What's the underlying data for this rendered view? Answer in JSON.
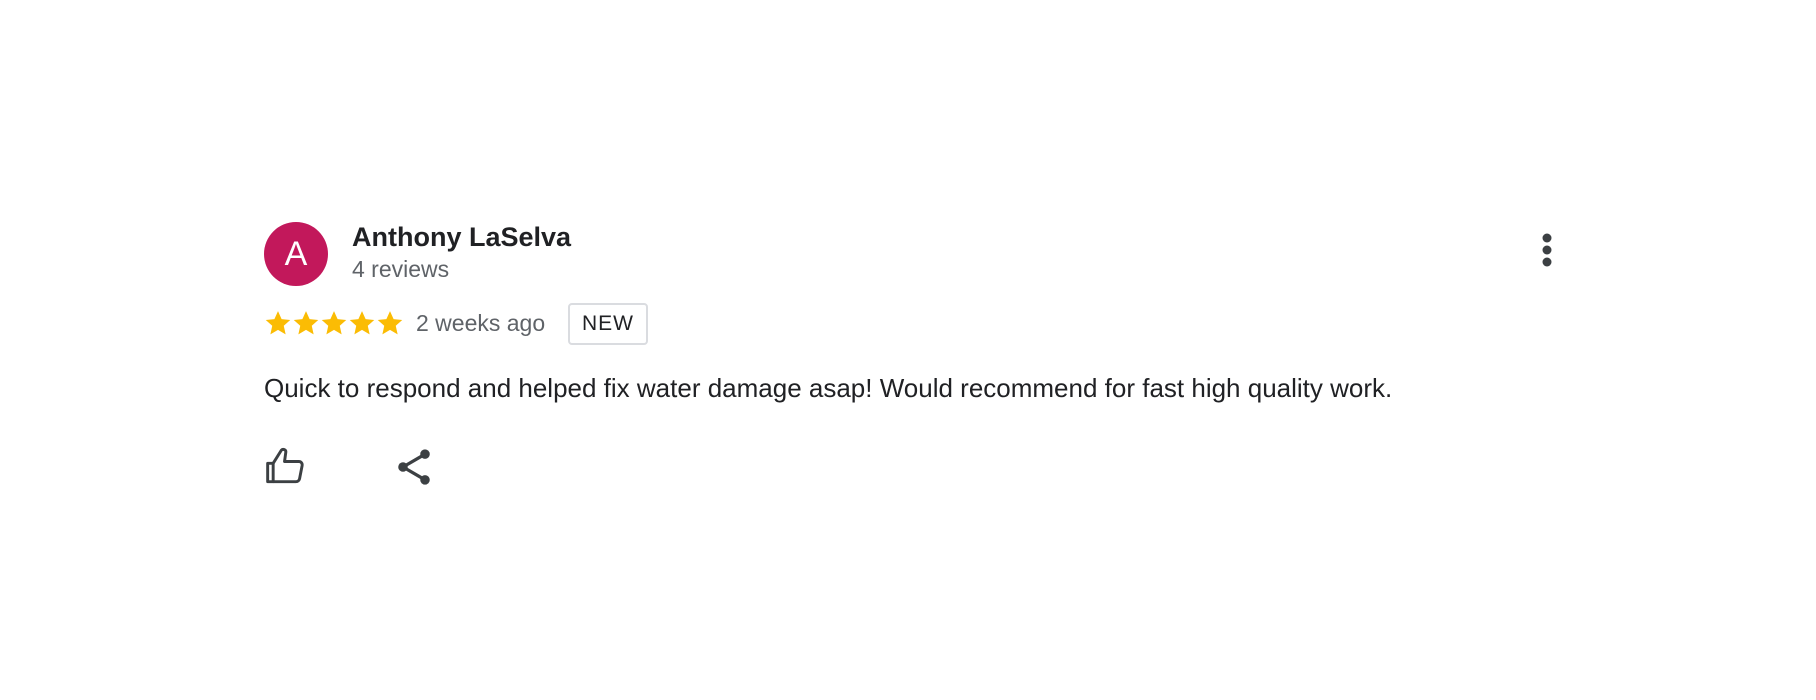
{
  "review": {
    "author": {
      "initial": "A",
      "name": "Anthony LaSelva",
      "meta": "4 reviews",
      "avatar_color": "#c2185b"
    },
    "rating": {
      "stars": 5,
      "max_stars": 5,
      "star_color": "#fbbc04"
    },
    "date": "2 weeks ago",
    "badge": "NEW",
    "text": "Quick to respond and helped fix water damage asap! Would recommend for fast high quality work.",
    "actions": {
      "like_icon": "thumbs-up-icon",
      "share_icon": "share-icon",
      "more_icon": "more-vert-icon"
    }
  }
}
